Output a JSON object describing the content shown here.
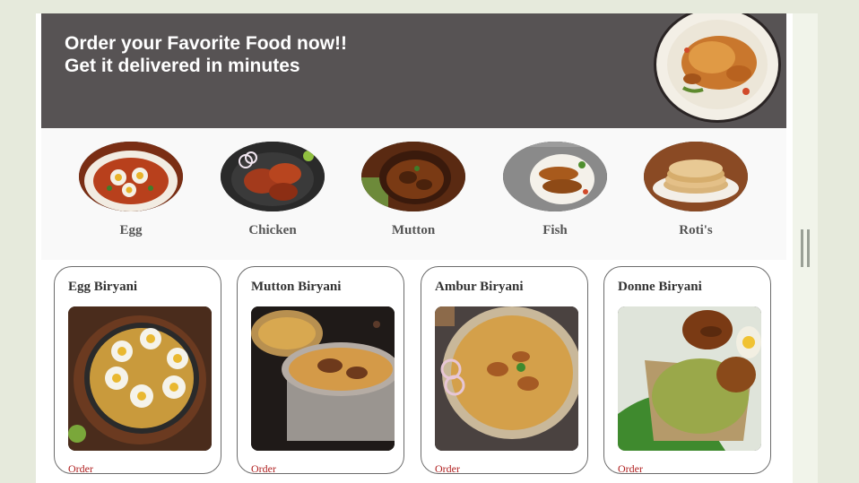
{
  "hero": {
    "line1": "Order your Favorite Food now!!",
    "line2": "Get it delivered in minutes",
    "background_color": "#575354"
  },
  "categories": [
    {
      "label": "Egg"
    },
    {
      "label": "Chicken"
    },
    {
      "label": "Mutton"
    },
    {
      "label": "Fish"
    },
    {
      "label": "Roti's"
    }
  ],
  "cards": [
    {
      "title": "Egg Biryani",
      "order_label": "Order"
    },
    {
      "title": "Mutton Biryani",
      "order_label": "Order"
    },
    {
      "title": "Ambur Biryani",
      "order_label": "Order"
    },
    {
      "title": "Donne Biryani",
      "order_label": "Order"
    }
  ],
  "colors": {
    "page_background": "#e6eadc",
    "order_link": "#b01f1f",
    "card_border": "#6b6b6b"
  }
}
